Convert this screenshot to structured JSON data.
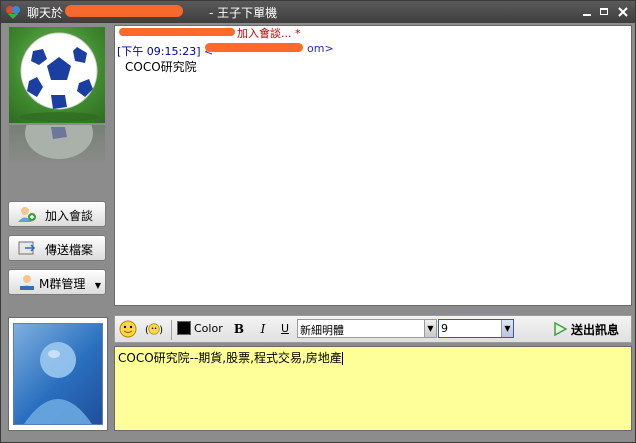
{
  "window": {
    "title_prefix": "聊天於",
    "title_suffix": "- 王子下單機"
  },
  "sidebar": {
    "buttons": [
      {
        "label": "加入會談",
        "icon": "add-contact-icon"
      },
      {
        "label": "傳送檔案",
        "icon": "send-file-icon"
      },
      {
        "label": "M群管理",
        "icon": "group-manage-icon"
      }
    ]
  },
  "chat": {
    "line1_suffix": "加入會談... *",
    "timestamp": "[下午 09:15:23]",
    "sender_open": "<",
    "sender_close": "om>",
    "message": "COCO研究院"
  },
  "toolbar": {
    "color_label": "Color",
    "bold_label": "B",
    "italic_label": "I",
    "underline_label": "U",
    "font_name": "新細明體",
    "font_size": "9",
    "send_label": "送出訊息"
  },
  "input": {
    "text": "COCO研究院--期貨,股票,程式交易,房地產"
  },
  "colors": {
    "titlebar": "#4a4a4a",
    "input_bg": "#ffff99",
    "timestamp": "#0000a0",
    "system_msg": "#c00000"
  }
}
